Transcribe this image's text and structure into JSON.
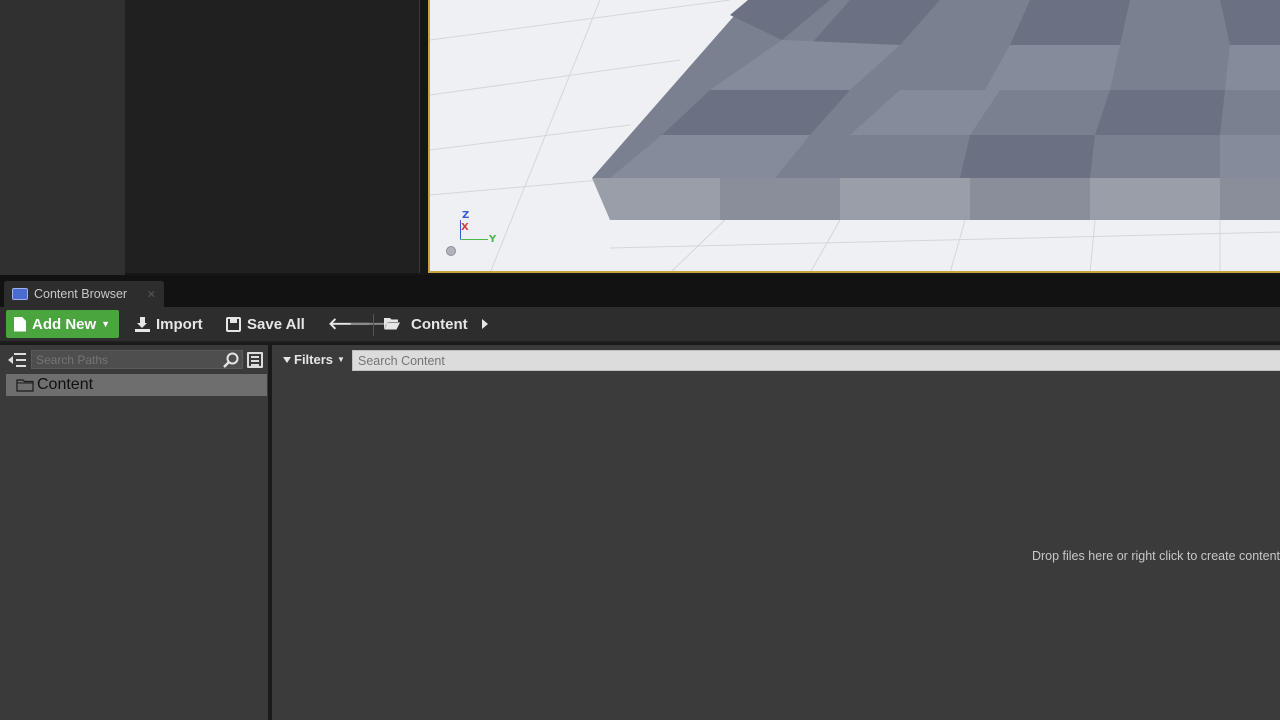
{
  "content_browser": {
    "tab_label": "Content Browser",
    "toolbar": {
      "add_new_label": "Add New",
      "import_label": "Import",
      "save_all_label": "Save All",
      "breadcrumb": "Content"
    },
    "sources": {
      "search_placeholder": "Search Paths",
      "tree": [
        {
          "label": "Content"
        }
      ]
    },
    "assets": {
      "filters_label": "Filters",
      "search_placeholder": "Search Content",
      "empty_hint": "Drop files here or right click to create content"
    }
  },
  "viewport": {
    "axis_labels": {
      "z": "Z",
      "x": "X",
      "y": "Y"
    }
  },
  "colors": {
    "accent_add_new": "#4aa53e",
    "viewport_selection_border": "#c9a43a"
  }
}
